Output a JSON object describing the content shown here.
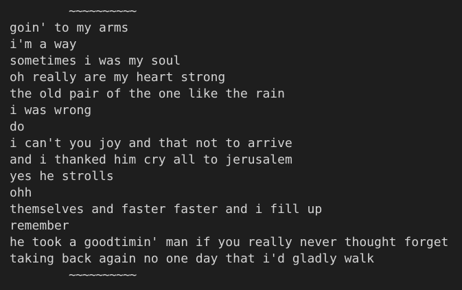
{
  "divider_top": "~~~~~~~~~~",
  "lines": [
    "goin' to my arms",
    "i'm a way",
    "sometimes i was my soul",
    "oh really are my heart strong",
    "the old pair of the one like the rain",
    "i was wrong",
    "do",
    "i can't you joy and that not to arrive",
    "and i thanked him cry all to jerusalem",
    "yes he strolls",
    "ohh",
    "themselves and faster faster and i fill up",
    "remember",
    "he took a goodtimin' man if you really never thought forget",
    "taking back again no one day that i'd gladly walk"
  ],
  "divider_bottom": "~~~~~~~~~~",
  "colors": {
    "background": "#1e1e1e",
    "text": "#d4d4d4"
  }
}
